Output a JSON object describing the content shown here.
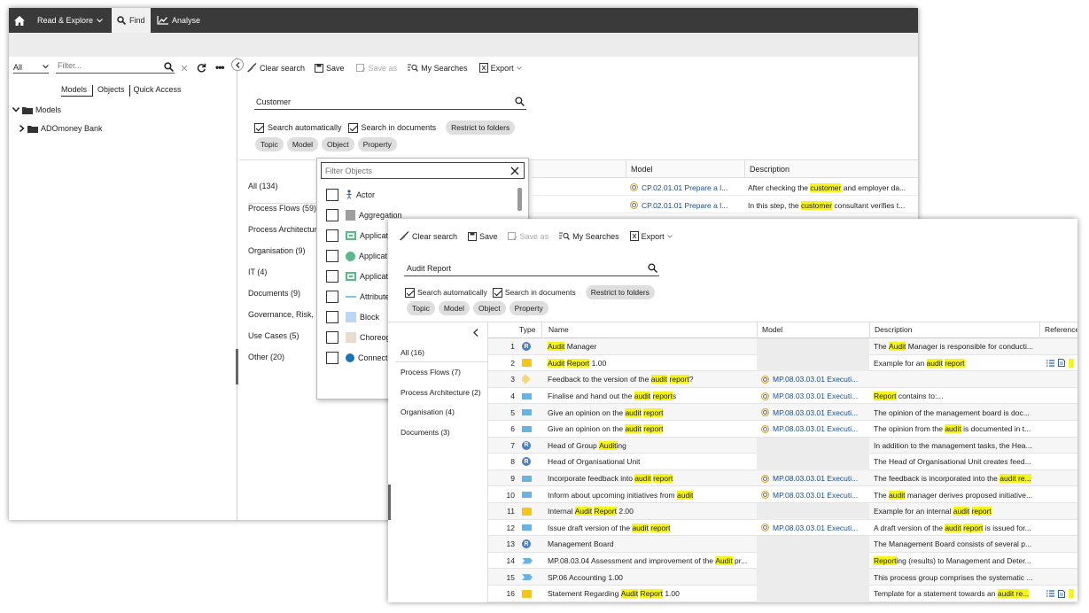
{
  "main": {
    "topbar": {
      "home_icon": "home-icon",
      "read_explore": "Read & Explore",
      "find": "Find",
      "analyse": "Analyse"
    },
    "left": {
      "scope_value": "All",
      "filter_placeholder": "Filter...",
      "tabs": [
        "Models",
        "Objects",
        "Quick Access"
      ],
      "tree_root": "Models",
      "tree_child": "ADOmoney Bank"
    },
    "toolbar": {
      "clear": "Clear search",
      "save": "Save",
      "save_as": "Save as",
      "my_searches": "My Searches",
      "export": "Export"
    },
    "search_value": "Customer",
    "options": {
      "search_auto": "Search automatically",
      "search_docs": "Search in documents",
      "restrict": "Restrict to folders"
    },
    "chips": [
      "Topic",
      "Model",
      "Object",
      "Property"
    ],
    "facets": [
      "All (134)",
      "Process Flows (59)",
      "Process Architectur",
      "Organisation (9)",
      "IT (4)",
      "Documents (9)",
      "Governance, Risk,",
      "Use Cases (5)",
      "Other (20)"
    ],
    "table_headers": {
      "model": "Model",
      "description": "Description"
    },
    "rows": [
      {
        "model": "CP.02.01.01 Prepare a l...",
        "desc_pre": "After checking the ",
        "desc_hl": "customer",
        "desc_post": " and employer da..."
      },
      {
        "model": "CP.02.01.01 Prepare a l...",
        "desc_pre": "In this step, the ",
        "desc_hl": "customer",
        "desc_post": " consultant verifies t..."
      }
    ]
  },
  "popup": {
    "placeholder": "Filter Objects",
    "items": [
      "Actor",
      "Aggregation",
      "Applicat",
      "Applicat",
      "Applicat",
      "Attribute",
      "Block",
      "Choreog",
      "Connect"
    ]
  },
  "front": {
    "toolbar": {
      "clear": "Clear search",
      "save": "Save",
      "save_as": "Save as",
      "my_searches": "My Searches",
      "export": "Export"
    },
    "search_value": "Audit Report",
    "options": {
      "search_auto": "Search automatically",
      "search_docs": "Search in documents",
      "restrict": "Restrict to folders"
    },
    "chips": [
      "Topic",
      "Model",
      "Object",
      "Property"
    ],
    "facets": [
      "All (16)",
      "Process Flows (7)",
      "Process Architecture (2)",
      "Organisation (4)",
      "Documents (3)"
    ],
    "headers": {
      "type": "Type",
      "name": "Name",
      "model": "Model",
      "description": "Description",
      "references": "Reference"
    },
    "rows": [
      {
        "n": "1",
        "type": "r",
        "name": [
          [
            "Audit",
            true
          ],
          [
            " Manager",
            false
          ]
        ],
        "model": "",
        "desc": [
          [
            "The ",
            false
          ],
          [
            "Audit",
            true
          ],
          [
            " Manager is responsible for conducti...",
            false
          ]
        ],
        "ref": false
      },
      {
        "n": "2",
        "type": "doc",
        "name": [
          [
            "Audit",
            true
          ],
          [
            " ",
            false
          ],
          [
            "Report",
            true
          ],
          [
            " 1.00",
            false
          ]
        ],
        "model": "",
        "desc": [
          [
            "Example for an ",
            false
          ],
          [
            "audit",
            true
          ],
          [
            " ",
            false
          ],
          [
            "report",
            true
          ]
        ],
        "ref": true
      },
      {
        "n": "3",
        "type": "dia",
        "name": [
          [
            "Feedback to the version of the ",
            false
          ],
          [
            "audit",
            true
          ],
          [
            " ",
            false
          ],
          [
            "report",
            true
          ],
          [
            "?",
            false
          ]
        ],
        "model": "MP.08.03.03.01 Executi...",
        "desc": [],
        "ref": false
      },
      {
        "n": "4",
        "type": "act",
        "name": [
          [
            "Finalise and hand out the ",
            false
          ],
          [
            "audit",
            true
          ],
          [
            " ",
            false
          ],
          [
            "report",
            true
          ],
          [
            "s",
            false
          ]
        ],
        "model": "MP.08.03.03.01 Executi...",
        "desc": [
          [
            "Report",
            true
          ],
          [
            " contains to:...",
            false
          ]
        ],
        "ref": false
      },
      {
        "n": "5",
        "type": "act",
        "name": [
          [
            "Give an opinion on the ",
            false
          ],
          [
            "audit",
            true
          ],
          [
            " ",
            false
          ],
          [
            "report",
            true
          ]
        ],
        "model": "MP.08.03.03.01 Executi...",
        "desc": [
          [
            "The opinion of the management board is doc...",
            false
          ]
        ],
        "ref": false
      },
      {
        "n": "6",
        "type": "act",
        "name": [
          [
            "Give an opinion on the ",
            false
          ],
          [
            "audit",
            true
          ],
          [
            " ",
            false
          ],
          [
            "report",
            true
          ]
        ],
        "model": "MP.08.03.03.01 Executi...",
        "desc": [
          [
            "The opinion from the ",
            false
          ],
          [
            "audit",
            true
          ],
          [
            " is documented in t...",
            false
          ]
        ],
        "ref": false
      },
      {
        "n": "7",
        "type": "r",
        "name": [
          [
            "Head of Group ",
            false
          ],
          [
            "Audit",
            true
          ],
          [
            "ing",
            false
          ]
        ],
        "model": "",
        "desc": [
          [
            "In addition to the management tasks, the Hea...",
            false
          ]
        ],
        "ref": false
      },
      {
        "n": "8",
        "type": "r",
        "name": [
          [
            "Head of Organisational Unit",
            false
          ]
        ],
        "model": "",
        "desc": [
          [
            "The Head of Organisational Unit creates feed...",
            false
          ]
        ],
        "ref": false
      },
      {
        "n": "9",
        "type": "act",
        "name": [
          [
            "Incorporate feedback into ",
            false
          ],
          [
            "audit",
            true
          ],
          [
            " ",
            false
          ],
          [
            "report",
            true
          ]
        ],
        "model": "MP.08.03.03.01 Executi...",
        "desc": [
          [
            "The feedback is incorporated into the ",
            false
          ],
          [
            "audit re...",
            true
          ]
        ],
        "ref": false
      },
      {
        "n": "10",
        "type": "act",
        "name": [
          [
            "Inform about upcoming initiatives from ",
            false
          ],
          [
            "audit",
            true
          ]
        ],
        "model": "MP.08.03.03.01 Executi...",
        "desc": [
          [
            "The ",
            false
          ],
          [
            "audit",
            true
          ],
          [
            " manager derives proposed initiative...",
            false
          ]
        ],
        "ref": false
      },
      {
        "n": "11",
        "type": "doc",
        "name": [
          [
            "Internal ",
            false
          ],
          [
            "Audit",
            true
          ],
          [
            " ",
            false
          ],
          [
            "Report",
            true
          ],
          [
            " 2.00",
            false
          ]
        ],
        "model": "",
        "desc": [
          [
            "Example for an internal ",
            false
          ],
          [
            "audit",
            true
          ],
          [
            " ",
            false
          ],
          [
            "report",
            true
          ]
        ],
        "ref": false
      },
      {
        "n": "12",
        "type": "act",
        "name": [
          [
            "Issue draft version of the ",
            false
          ],
          [
            "audit",
            true
          ],
          [
            " ",
            false
          ],
          [
            "report",
            true
          ]
        ],
        "model": "MP.08.03.03.01 Executi...",
        "desc": [
          [
            "A draft version of the ",
            false
          ],
          [
            "audit",
            true
          ],
          [
            " ",
            false
          ],
          [
            "report",
            true
          ],
          [
            " is issued for...",
            false
          ]
        ],
        "ref": false
      },
      {
        "n": "13",
        "type": "r",
        "name": [
          [
            "Management Board",
            false
          ]
        ],
        "model": "",
        "desc": [
          [
            "The Management Board consists of several p...",
            false
          ]
        ],
        "ref": false
      },
      {
        "n": "14",
        "type": "chev",
        "name": [
          [
            "MP.08.03.04 Assessment and improvement of the ",
            false
          ],
          [
            "Audit",
            true
          ],
          [
            " pr...",
            false
          ]
        ],
        "model": "",
        "desc": [
          [
            "Report",
            true
          ],
          [
            "ing (results) to Management and Deter...",
            false
          ]
        ],
        "ref": false
      },
      {
        "n": "15",
        "type": "chev",
        "name": [
          [
            "SP.06 Accounting 1.00",
            false
          ]
        ],
        "model": "",
        "desc": [
          [
            "This process group comprises the systematic ...",
            false
          ]
        ],
        "ref": false
      },
      {
        "n": "16",
        "type": "doc",
        "name": [
          [
            "Statement Regarding ",
            false
          ],
          [
            "Audit",
            true
          ],
          [
            " ",
            false
          ],
          [
            "Report",
            true
          ],
          [
            " 1.00",
            false
          ]
        ],
        "model": "",
        "desc": [
          [
            "Template for a statement towards an ",
            false
          ],
          [
            "audit re...",
            true
          ]
        ],
        "ref": true
      }
    ]
  }
}
